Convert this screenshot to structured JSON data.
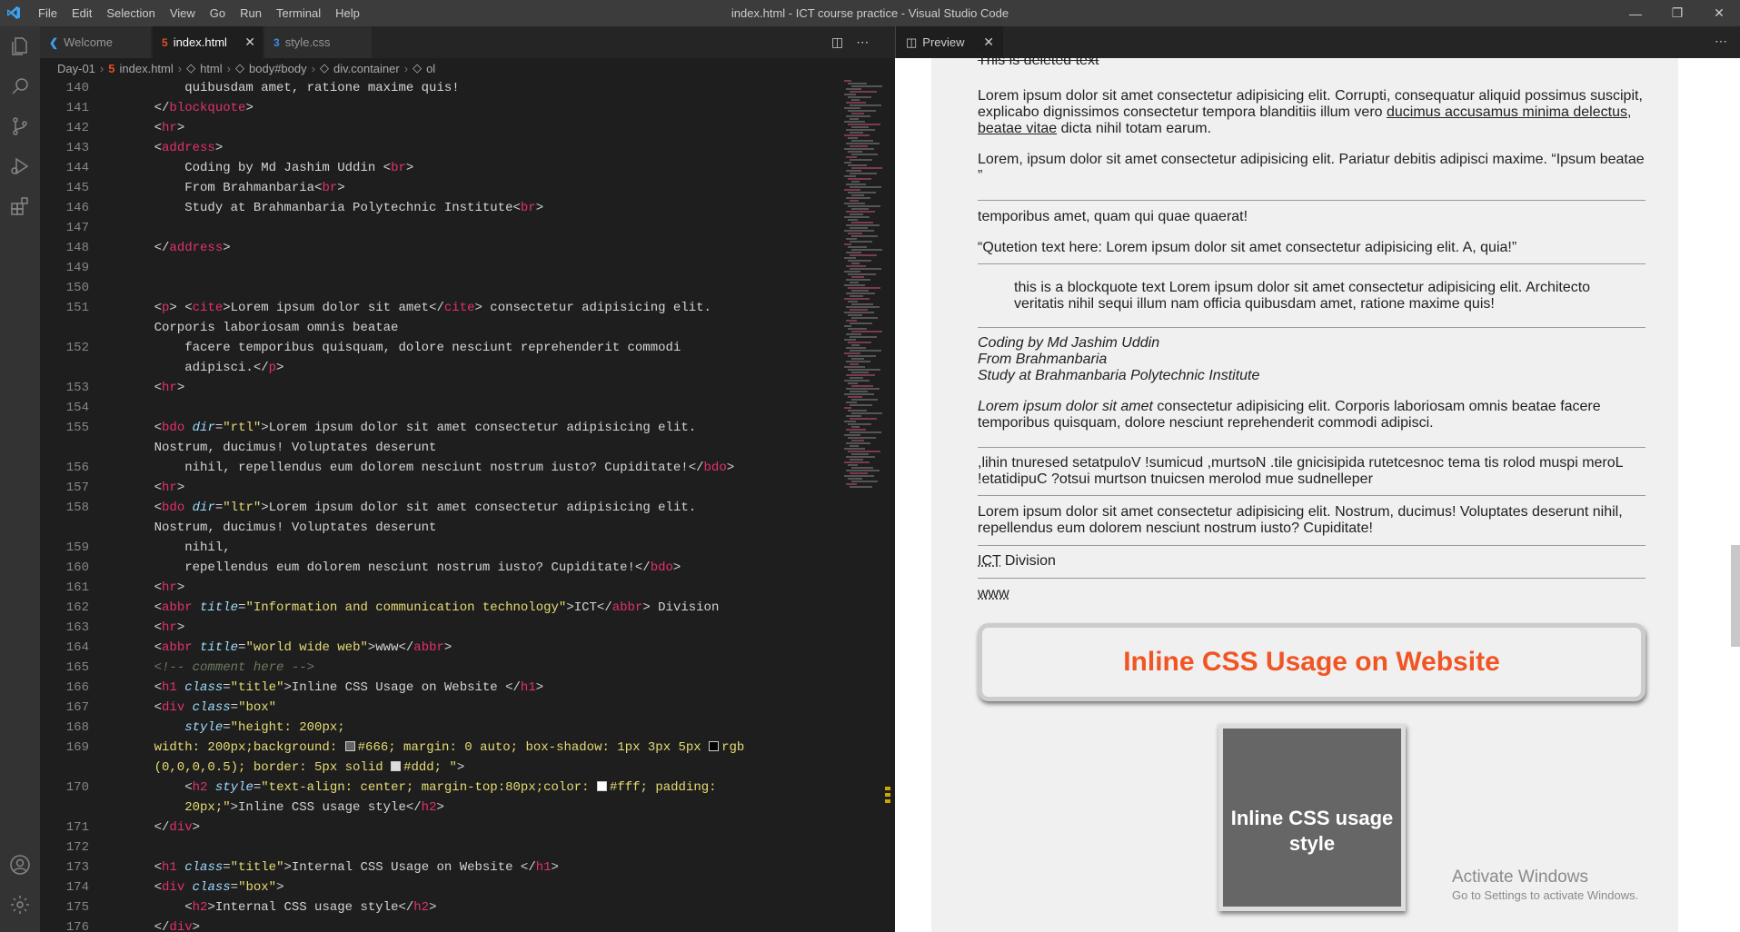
{
  "window": {
    "title": "index.html - ICT course practice - Visual Studio Code",
    "menu": [
      "File",
      "Edit",
      "Selection",
      "View",
      "Go",
      "Run",
      "Terminal",
      "Help"
    ]
  },
  "tabs": [
    {
      "label": "Welcome",
      "icon": "vscode-icon"
    },
    {
      "label": "index.html",
      "icon": "html-icon",
      "active": true
    },
    {
      "label": "style.css",
      "icon": "css-icon"
    }
  ],
  "breadcrumb": [
    "Day-01",
    "index.html",
    "html",
    "body#body",
    "div.container",
    "ol"
  ],
  "editor": {
    "lines": [
      {
        "n": "140",
        "html": "        quibusdam amet, ratione maxime quis!"
      },
      {
        "n": "141",
        "html": "    &lt;/<span class='t'>blockquote</span>&gt;"
      },
      {
        "n": "142",
        "html": "    &lt;<span class='t'>hr</span>&gt;"
      },
      {
        "n": "143",
        "html": "    &lt;<span class='t'>address</span>&gt;"
      },
      {
        "n": "144",
        "html": "        Coding by Md Jashim Uddin &lt;<span class='t'>br</span>&gt;"
      },
      {
        "n": "145",
        "html": "        From Brahmanbaria&lt;<span class='t'>br</span>&gt;"
      },
      {
        "n": "146",
        "html": "        Study at Brahmanbaria Polytechnic Institute&lt;<span class='t'>br</span>&gt;"
      },
      {
        "n": "147",
        "html": ""
      },
      {
        "n": "148",
        "html": "    &lt;/<span class='t'>address</span>&gt;"
      },
      {
        "n": "149",
        "html": ""
      },
      {
        "n": "150",
        "html": ""
      },
      {
        "n": "151",
        "html": "    &lt;<span class='t'>p</span>&gt; &lt;<span class='t'>cite</span>&gt;Lorem ipsum dolor sit amet&lt;/<span class='t'>cite</span>&gt; consectetur adipisicing elit."
      },
      {
        "n": "",
        "html": "    Corporis laboriosam omnis beatae"
      },
      {
        "n": "152",
        "html": "        facere temporibus quisquam, dolore nesciunt reprehenderit commodi"
      },
      {
        "n": "",
        "html": "        adipisci.&lt;/<span class='t'>p</span>&gt;"
      },
      {
        "n": "153",
        "html": "    &lt;<span class='t'>hr</span>&gt;"
      },
      {
        "n": "154",
        "html": ""
      },
      {
        "n": "155",
        "html": "    &lt;<span class='t'>bdo</span> <span class='a'>dir</span>=<span class='s'>\"rtl\"</span>&gt;Lorem ipsum dolor sit amet consectetur adipisicing elit."
      },
      {
        "n": "",
        "html": "    Nostrum, ducimus! Voluptates deserunt"
      },
      {
        "n": "156",
        "html": "        nihil, repellendus eum dolorem nesciunt nostrum iusto? Cupiditate!&lt;/<span class='t'>bdo</span>&gt;"
      },
      {
        "n": "157",
        "html": "    &lt;<span class='t'>hr</span>&gt;"
      },
      {
        "n": "158",
        "html": "    &lt;<span class='t'>bdo</span> <span class='a'>dir</span>=<span class='s'>\"ltr\"</span>&gt;Lorem ipsum dolor sit amet consectetur adipisicing elit."
      },
      {
        "n": "",
        "html": "    Nostrum, ducimus! Voluptates deserunt"
      },
      {
        "n": "159",
        "html": "        nihil,"
      },
      {
        "n": "160",
        "html": "        repellendus eum dolorem nesciunt nostrum iusto? Cupiditate!&lt;/<span class='t'>bdo</span>&gt;"
      },
      {
        "n": "161",
        "html": "    &lt;<span class='t'>hr</span>&gt;"
      },
      {
        "n": "162",
        "html": "    &lt;<span class='t'>abbr</span> <span class='a'>title</span>=<span class='s'>\"Information and communication technology\"</span>&gt;ICT&lt;/<span class='t'>abbr</span>&gt; Division"
      },
      {
        "n": "163",
        "html": "    &lt;<span class='t'>hr</span>&gt;"
      },
      {
        "n": "164",
        "html": "    &lt;<span class='t'>abbr</span> <span class='a'>title</span>=<span class='s'>\"world wide web\"</span>&gt;www&lt;/<span class='t'>abbr</span>&gt;"
      },
      {
        "n": "165",
        "html": "    <span class='c'>&lt;!-- comment here --&gt;</span>"
      },
      {
        "n": "166",
        "html": "    &lt;<span class='t'>h1</span> <span class='a'>class</span>=<span class='s'>\"title\"</span>&gt;Inline CSS Usage on Website &lt;/<span class='t'>h1</span>&gt;"
      },
      {
        "n": "167",
        "html": "    &lt;<span class='t'>div</span> <span class='a'>class</span>=<span class='s'>\"box\"</span>"
      },
      {
        "n": "168",
        "html": "        <span class='a'>style</span>=<span class='s'>\"height: 200px;</span>"
      },
      {
        "n": "169",
        "html": "<span class='s'>    width: 200px;background: <span class='sw' style='background:#666'></span>#666; margin: 0 auto; box-shadow: 1px 3px 5px <span class='sw' style='background:#000'></span>rgb</span>"
      },
      {
        "n": "",
        "html": "<span class='s'>    (0,0,0,0.5); border: 5px solid <span class='sw' style='background:#ddd'></span>#ddd; \"</span>&gt;"
      },
      {
        "n": "170",
        "html": "        &lt;<span class='t'>h2</span> <span class='a'>style</span>=<span class='s'>\"text-align: center; margin-top:80px;color: <span class='sw' style='background:#fff'></span>#fff; padding:</span>"
      },
      {
        "n": "",
        "html": "<span class='s'>        20px;\"</span>&gt;Inline CSS usage style&lt;/<span class='t'>h2</span>&gt;"
      },
      {
        "n": "171",
        "html": "    &lt;/<span class='t'>div</span>&gt;"
      },
      {
        "n": "172",
        "html": ""
      },
      {
        "n": "173",
        "html": "    &lt;<span class='t'>h1</span> <span class='a'>class</span>=<span class='s'>\"title\"</span>&gt;Internal CSS Usage on Website &lt;/<span class='t'>h1</span>&gt;"
      },
      {
        "n": "174",
        "html": "    &lt;<span class='t'>div</span> <span class='a'>class</span>=<span class='s'>\"box\"</span>&gt;"
      },
      {
        "n": "175",
        "html": "        &lt;<span class='t'>h2</span>&gt;Internal CSS usage style&lt;/<span class='t'>h2</span>&gt;"
      },
      {
        "n": "176",
        "html": "    &lt;/<span class='t'>div</span>&gt;"
      }
    ]
  },
  "preview": {
    "tab_label": "Preview",
    "deleted": "This is deleted text",
    "p1a": "Lorem ipsum dolor sit amet consectetur adipisicing elit. Corrupti, consequatur aliquid possimus suscipit, explicabo dignissimos consectetur tempora blanditiis illum vero ",
    "p1u": "ducimus accusamus minima delectus, beatae vitae",
    "p1b": " dicta nihil totam earum.",
    "p2": "Lorem, ipsum dolor sit amet consectetur adipisicing elit. Pariatur debitis adipisci maxime. “Ipsum beatae ”",
    "p3": "temporibus amet, quam qui quae quaerat!",
    "quote": "“Qutetion text here: Lorem ipsum dolor sit amet consectetur adipisicing elit. A, quia!”",
    "blockquote": "this is a blockquote text Lorem ipsum dolor sit amet consectetur adipisicing elit. Architecto veritatis nihil sequi illum nam officia quibusdam amet, ratione maxime quis!",
    "address": [
      "Coding by Md Jashim Uddin",
      "From Brahmanbaria",
      "Study at Brahmanbaria Polytechnic Institute"
    ],
    "cite": "Lorem ipsum dolor sit amet",
    "cite_rest": " consectetur adipisicing elit. Corporis laboriosam omnis beatae facere temporibus quisquam, dolore nesciunt reprehenderit commodi adipisci.",
    "rtl": ",lihin tnuresed setatpuloV !sumicud ,murtsoN .tile gnicisipida rutetcesnoc tema tis rolod muspi meroL !etatidipuC ?otsui murtson tnuicsen merolod mue sudnelleper",
    "ltr": "Lorem ipsum dolor sit amet consectetur adipisicing elit. Nostrum, ducimus! Voluptates deserunt nihil, repellendus eum dolorem nesciunt nostrum iusto? Cupiditate!",
    "abbr1": "ICT",
    "abbr1_rest": " Division",
    "abbr2": "www",
    "h1": "Inline CSS Usage on Website",
    "box_h2": "Inline CSS usage style"
  },
  "watermark": {
    "line1": "Activate Windows",
    "line2": "Go to Settings to activate Windows."
  },
  "colors": {
    "accent": "#f05523",
    "tag": "#e2316d",
    "string": "#e6db74",
    "attr": "#9cdcfe"
  }
}
